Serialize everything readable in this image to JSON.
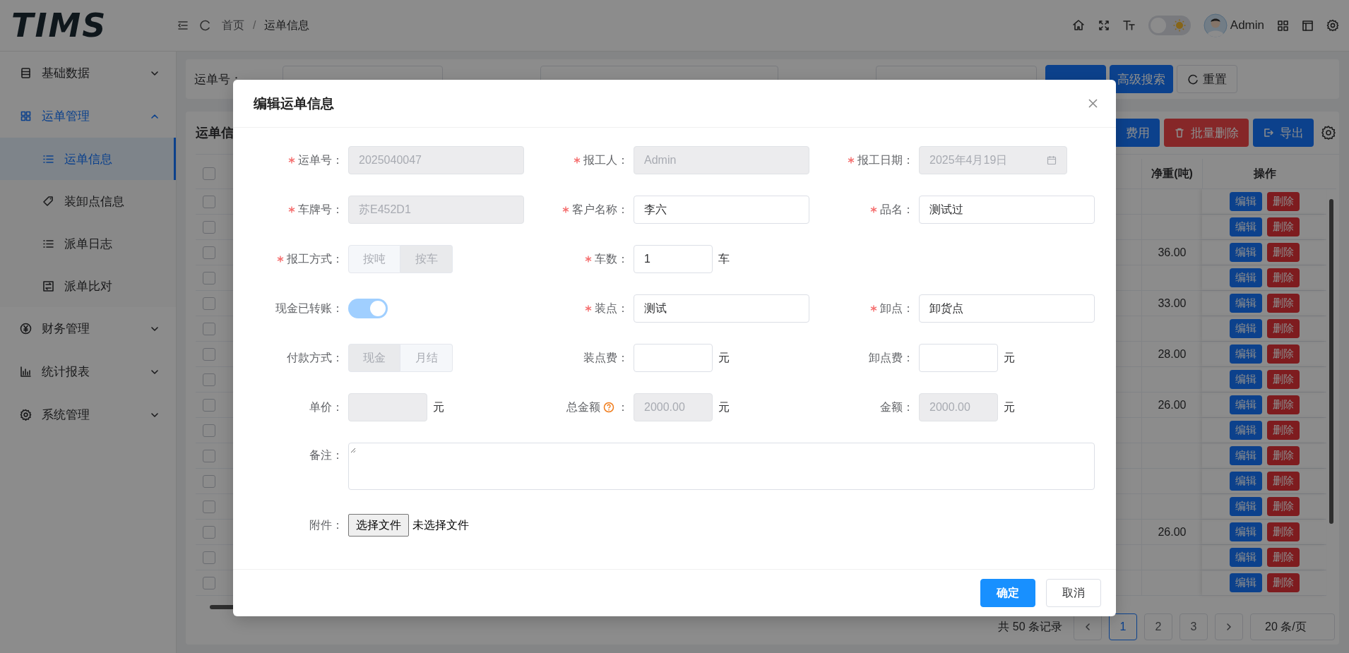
{
  "header": {
    "logo": "TIMS",
    "breadcrumb": [
      "首页",
      "运单信息"
    ],
    "separator": "/",
    "dark_mode": {
      "on": false
    },
    "user": "Admin"
  },
  "sidebar": {
    "items": [
      {
        "label": "基础数据",
        "expanded": false
      },
      {
        "label": "运单管理",
        "expanded": true,
        "children": [
          {
            "label": "运单信息",
            "selected": true
          },
          {
            "label": "装卸点信息",
            "selected": false
          },
          {
            "label": "派单日志",
            "selected": false
          },
          {
            "label": "派单比对",
            "selected": false
          }
        ]
      },
      {
        "label": "财务管理",
        "expanded": false
      },
      {
        "label": "统计报表",
        "expanded": false
      },
      {
        "label": "系统管理",
        "expanded": false
      }
    ]
  },
  "search": {
    "label": "运单号：",
    "buttons": [
      "高级搜索",
      "重置"
    ]
  },
  "table": {
    "title": "运单信",
    "toolbar": [
      {
        "label": "费用",
        "kind": "primary"
      },
      {
        "label": "批量删除",
        "kind": "danger"
      },
      {
        "label": "导出",
        "kind": "primary"
      }
    ],
    "header_checked": false,
    "columns": [
      "净重(吨)",
      "操作"
    ],
    "rows": [
      {
        "checked": false,
        "actions": [
          "编辑",
          "删除"
        ]
      },
      {
        "checked": false,
        "actions": [
          "编辑",
          "删除"
        ]
      },
      {
        "checked": false,
        "net_weight": "36.00",
        "actions": [
          "编辑",
          "删除"
        ]
      },
      {
        "checked": false,
        "actions": [
          "编辑",
          "删除"
        ]
      },
      {
        "checked": false,
        "net_weight": "33.00",
        "actions": [
          "编辑",
          "删除"
        ]
      },
      {
        "checked": false,
        "actions": [
          "编辑",
          "删除"
        ]
      },
      {
        "checked": false,
        "net_weight": "28.00",
        "actions": [
          "编辑",
          "删除"
        ]
      },
      {
        "checked": false,
        "actions": [
          "编辑",
          "删除"
        ]
      },
      {
        "checked": false,
        "net_weight": "26.00",
        "actions": [
          "编辑",
          "删除"
        ]
      },
      {
        "checked": false,
        "actions": [
          "编辑",
          "删除"
        ]
      },
      {
        "checked": false,
        "actions": [
          "编辑",
          "删除"
        ]
      },
      {
        "checked": false,
        "actions": [
          "编辑",
          "删除"
        ]
      },
      {
        "checked": false,
        "actions": [
          "编辑",
          "删除"
        ]
      },
      {
        "checked": false,
        "net_weight": "26.00",
        "actions": [
          "编辑",
          "删除"
        ]
      },
      {
        "checked": false,
        "actions": [
          "编辑",
          "删除"
        ]
      },
      {
        "checked": false,
        "actions": [
          "编辑",
          "删除"
        ]
      }
    ],
    "pagination": {
      "total": "共 50 条记录",
      "pages": [
        {
          "label": "1",
          "selected": true
        },
        {
          "label": "2",
          "selected": false
        },
        {
          "label": "3",
          "selected": false
        }
      ],
      "page_size": "20 条/页"
    }
  },
  "dialog": {
    "title": "编辑运单信息",
    "rows": [
      [
        {
          "kind": "text",
          "label": "运单号：",
          "required": true,
          "value": "2025040047",
          "disabled": true
        },
        {
          "kind": "text",
          "label": "报工人：",
          "required": true,
          "value": "Admin",
          "disabled": true
        },
        {
          "kind": "date",
          "label": "报工日期：",
          "required": true,
          "value": "2025年4月19日",
          "disabled": true
        }
      ],
      [
        {
          "kind": "text",
          "label": "车牌号：",
          "required": true,
          "value": "苏E452D1",
          "disabled": true
        },
        {
          "kind": "text",
          "label": "客户名称：",
          "required": true,
          "value": "李六",
          "disabled": false
        },
        {
          "kind": "text",
          "label": "品名：",
          "required": true,
          "value": "测试过",
          "disabled": false
        }
      ],
      [
        {
          "kind": "segmented",
          "label": "报工方式：",
          "required": true,
          "disabled": true,
          "options": [
            {
              "label": "按吨",
              "selected": false
            },
            {
              "label": "按车",
              "selected": true
            }
          ]
        },
        {
          "kind": "number",
          "label": "车数：",
          "required": true,
          "value": "1",
          "unit": "车",
          "disabled": false
        }
      ],
      [
        {
          "kind": "switch",
          "label": "现金已转账：",
          "required": false,
          "on": true
        },
        {
          "kind": "text",
          "label": "装点：",
          "required": true,
          "value": "测试",
          "disabled": false
        },
        {
          "kind": "text",
          "label": "卸点：",
          "required": true,
          "value": "卸货点",
          "disabled": false
        }
      ],
      [
        {
          "kind": "segmented",
          "label": "付款方式：",
          "required": false,
          "disabled": true,
          "options": [
            {
              "label": "现金",
              "selected": true
            },
            {
              "label": "月结",
              "selected": false
            }
          ]
        },
        {
          "kind": "number",
          "label": "装点费：",
          "required": false,
          "unit": "元",
          "disabled": false
        },
        {
          "kind": "number",
          "label": "卸点费：",
          "required": false,
          "unit": "元",
          "disabled": false
        }
      ],
      [
        {
          "kind": "number",
          "label": "单价：",
          "required": false,
          "unit": "元",
          "disabled": true
        },
        {
          "kind": "number",
          "label": "总金额",
          "help": true,
          "colon": "：",
          "required": false,
          "value": "2000.00",
          "unit": "元",
          "disabled": true
        },
        {
          "kind": "number",
          "label": "金额：",
          "required": false,
          "value": "2000.00",
          "unit": "元",
          "disabled": true
        }
      ],
      [
        {
          "kind": "textarea",
          "label": "备注：",
          "required": false
        }
      ],
      [
        {
          "kind": "file",
          "label": "附件：",
          "required": false,
          "button": "选择文件",
          "status": "未选择文件"
        }
      ]
    ],
    "buttons": [
      {
        "label": "确定",
        "kind": "primary"
      },
      {
        "label": "取消",
        "kind": "default"
      }
    ]
  }
}
